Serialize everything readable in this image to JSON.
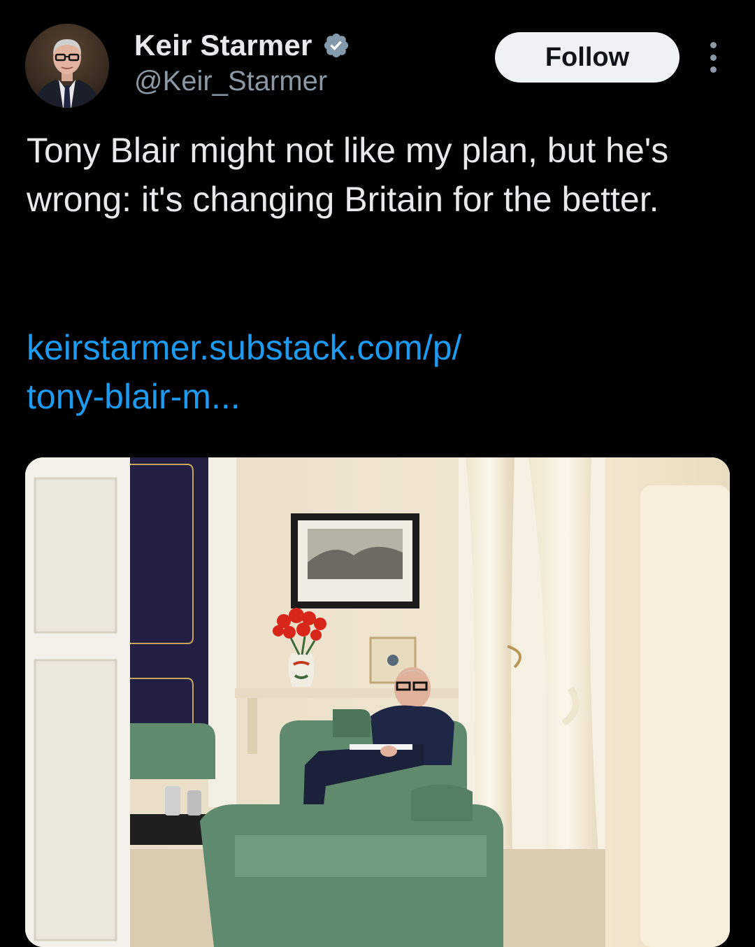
{
  "author": {
    "display_name": "Keir Starmer",
    "handle": "@Keir_Starmer",
    "verified": true,
    "avatar_icon": "profile-photo"
  },
  "actions": {
    "follow_label": "Follow",
    "more_icon": "more-vertical-icon"
  },
  "tweet": {
    "text": "Tony Blair might not like my plan, but he's wrong: it's changing Britain for the better.",
    "link_line_1": "keirstarmer.substack.com/p/",
    "link_line_2": "tony-blair-m..."
  },
  "media": {
    "type": "photo"
  },
  "colors": {
    "background": "#000000",
    "text_primary": "#e7e9ea",
    "text_secondary": "#8b98a5",
    "link": "#1d9bf0",
    "verified_badge": "#829aab",
    "follow_button_bg": "#eff3f4"
  }
}
